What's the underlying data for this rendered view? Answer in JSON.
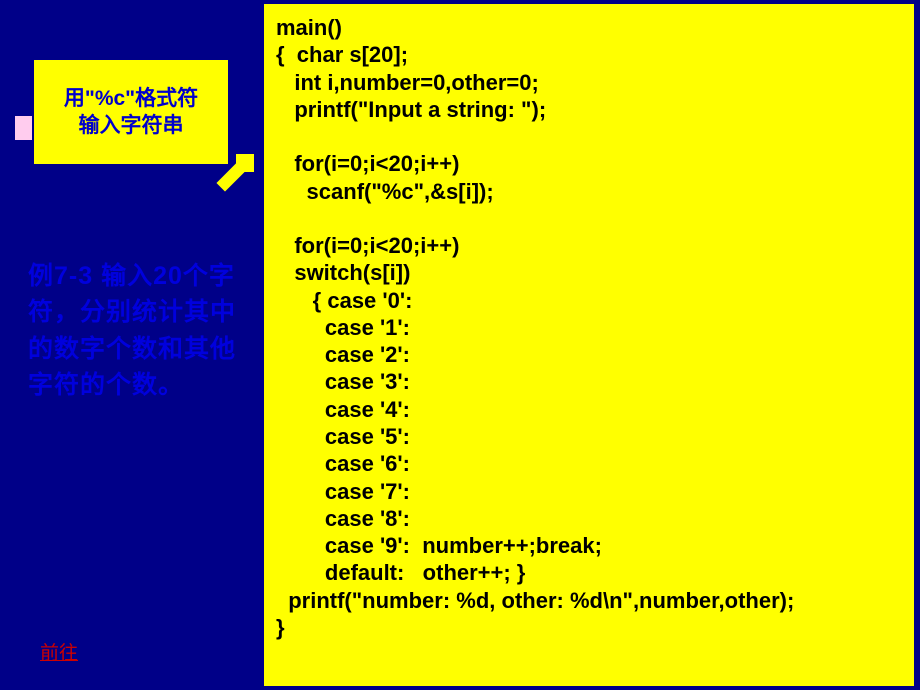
{
  "callout": {
    "line1": "用\"%c\"格式符",
    "line2": "输入字符串"
  },
  "example": {
    "text": "例7-3  输入20个字符，分别统计其中的数字个数和其他字符的个数。"
  },
  "code": {
    "content": "main()\n{  char s[20];\n   int i,number=0,other=0;\n   printf(\"Input a string: \");\n\n   for(i=0;i<20;i++)\n     scanf(\"%c\",&s[i]);\n\n   for(i=0;i<20;i++)\n   switch(s[i])\n      { case '0':\n        case '1':\n        case '2':\n        case '3':\n        case '4':\n        case '5':\n        case '6':\n        case '7':\n        case '8':\n        case '9':  number++;break;\n        default:   other++; }\n  printf(\"number: %d, other: %d\\n\",number,other);\n}"
  },
  "navigation": {
    "back": "前往"
  },
  "colors": {
    "background": "#000088",
    "highlight": "#ffff00",
    "text_blue": "#0000cc",
    "text_red": "#cc0000"
  }
}
